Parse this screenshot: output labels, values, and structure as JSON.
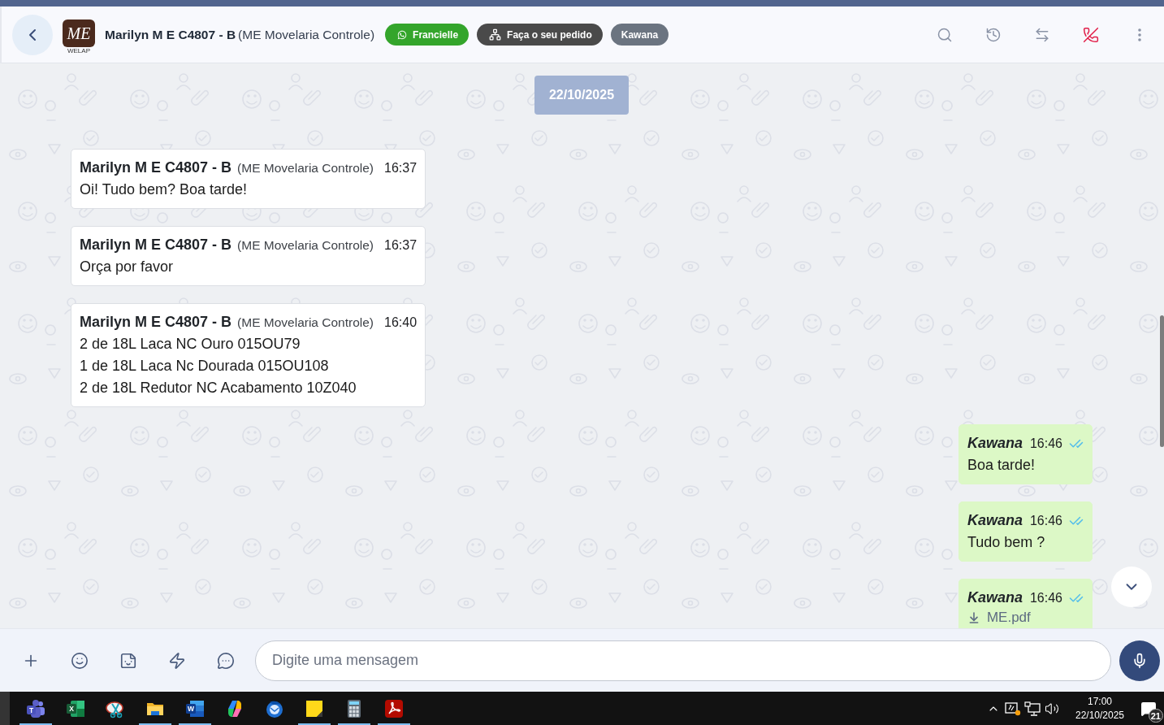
{
  "header": {
    "contact": {
      "logo_text": "ME",
      "logo_tagline": "WELAP",
      "name": "Marilyn M E C4807 - B",
      "organization": "(ME Movelaria Controle)"
    },
    "tags": [
      {
        "kind": "whatsapp",
        "label": "Francielle",
        "color": "#34a52b"
      },
      {
        "kind": "flow",
        "label": "Faça o seu pedido",
        "color": "#4a4a4a"
      },
      {
        "kind": "plain",
        "label": "Kawana",
        "color": "#6b7480"
      }
    ],
    "actions": [
      {
        "kind": "search"
      },
      {
        "kind": "history"
      },
      {
        "kind": "transfer"
      },
      {
        "kind": "end-call"
      },
      {
        "kind": "more"
      }
    ]
  },
  "date_divider": "22/10/2025",
  "messages": [
    {
      "kind": "incoming",
      "sender": "Marilyn M E C4807 - B",
      "organization": "(ME Movelaria Controle)",
      "time": "16:37",
      "lines": [
        "Oi! Tudo bem? Boa tarde!"
      ]
    },
    {
      "kind": "incoming",
      "sender": "Marilyn M E C4807 - B",
      "organization": "(ME Movelaria Controle)",
      "time": "16:37",
      "lines": [
        "Orça por favor"
      ]
    },
    {
      "kind": "incoming",
      "sender": "Marilyn M E C4807 - B",
      "organization": "(ME Movelaria Controle)",
      "time": "16:40",
      "lines": [
        "2 de 18L Laca NC Ouro 015OU79",
        "1 de 18L Laca Nc Dourada 015OU108",
        "2 de 18L Redutor NC Acabamento 10Z040"
      ]
    },
    {
      "kind": "outgoing",
      "sender": "Kawana",
      "time": "16:46",
      "read": true,
      "lines": [
        "Boa tarde!"
      ]
    },
    {
      "kind": "outgoing",
      "sender": "Kawana",
      "time": "16:46",
      "read": true,
      "lines": [
        "Tudo bem ?"
      ]
    },
    {
      "kind": "outgoing",
      "sender": "Kawana",
      "time": "16:46",
      "read": true,
      "attachment": "ME.pdf"
    }
  ],
  "composer": {
    "tools": [
      {
        "kind": "add"
      },
      {
        "kind": "emoji"
      },
      {
        "kind": "sticker"
      },
      {
        "kind": "quick-reply"
      },
      {
        "kind": "chat"
      }
    ],
    "placeholder": "Digite uma mensagem"
  },
  "taskbar": {
    "apps": [
      {
        "kind": "teams",
        "glyph": "T",
        "running": true
      },
      {
        "kind": "excel",
        "glyph": "X",
        "running": false
      },
      {
        "kind": "snipping",
        "running": false
      },
      {
        "kind": "explorer",
        "running": true
      },
      {
        "kind": "word",
        "glyph": "W",
        "running": true
      },
      {
        "kind": "copilot",
        "running": false
      },
      {
        "kind": "thunderbird",
        "running": false
      },
      {
        "kind": "sticky-notes",
        "running": true
      },
      {
        "kind": "calculator",
        "running": true
      },
      {
        "kind": "acrobat",
        "running": true
      }
    ],
    "tray": {
      "time": "17:00",
      "date": "22/10/2025",
      "notifications": "21"
    }
  }
}
